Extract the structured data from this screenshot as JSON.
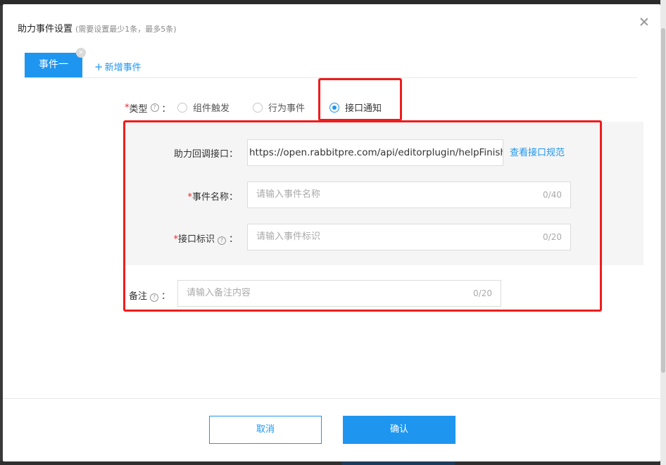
{
  "dialog": {
    "title": "助力事件设置",
    "subtitle": "(需要设置最少1条，最多5条)",
    "close_icon": "close-icon"
  },
  "tabs": {
    "active_label": "事件一",
    "close_glyph": "×",
    "add_label": "新增事件",
    "add_glyph": "+"
  },
  "type_field": {
    "required_mark": "*",
    "label": "类型",
    "help_glyph": "?",
    "colon": "：",
    "options": [
      "组件触发",
      "行为事件",
      "接口通知"
    ],
    "selected": "接口通知"
  },
  "callback": {
    "label": "助力回调接口：",
    "value": "https://open.rabbitpre.com/api/editorplugin/helpFinish",
    "link": "查看接口规范"
  },
  "event_name": {
    "required_mark": "*",
    "label": "事件名称：",
    "placeholder": "请输入事件名称",
    "counter": "0/40"
  },
  "interface_id": {
    "required_mark": "*",
    "label": "接口标识",
    "help_glyph": "?",
    "colon": "：",
    "placeholder": "请输入事件标识",
    "counter": "0/20"
  },
  "remark": {
    "label": "备注",
    "help_glyph": "?",
    "colon": "：",
    "placeholder": "请输入备注内容",
    "counter": "0/20"
  },
  "footer": {
    "cancel_label": "取消",
    "confirm_label": "确认"
  },
  "colors": {
    "accent": "#1e96f0",
    "highlight": "#f01c1c",
    "required": "#f5222d"
  }
}
